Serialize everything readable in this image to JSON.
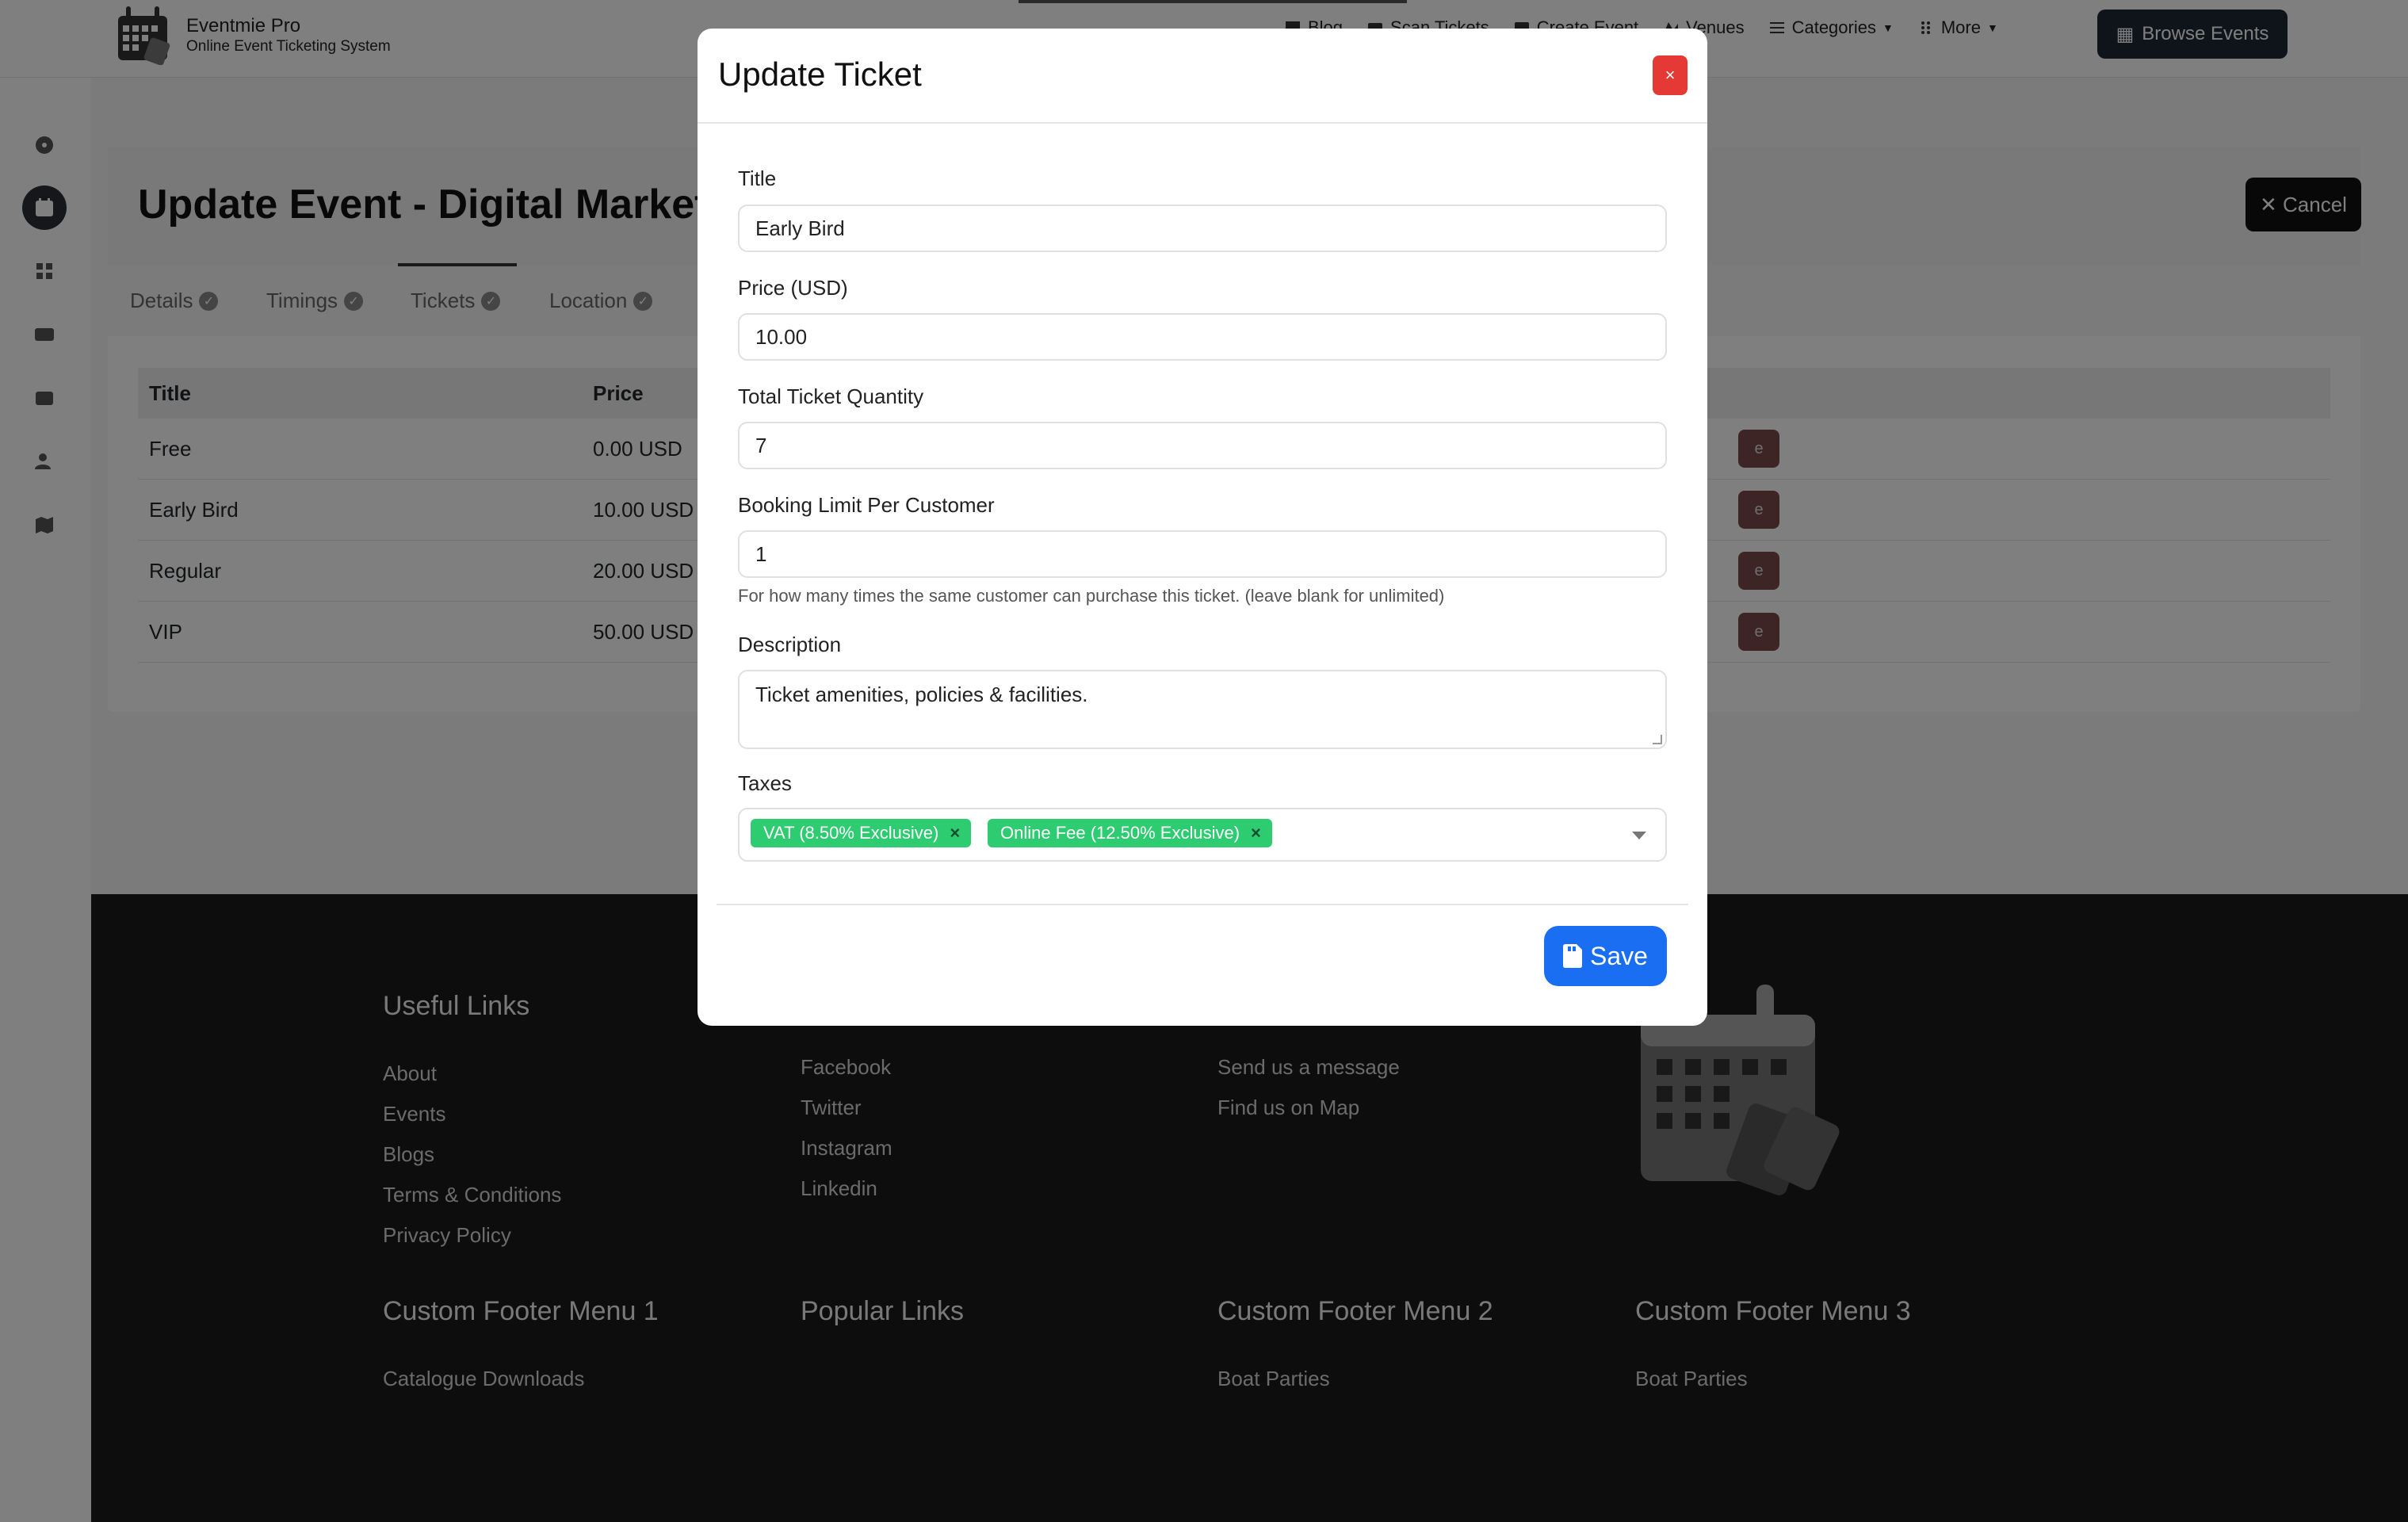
{
  "header": {
    "brand_name": "Eventmie Pro",
    "brand_tagline": "Online Event Ticketing System",
    "nav": [
      {
        "label": "Blog",
        "icon": "blog-icon"
      },
      {
        "label": "Scan Tickets",
        "icon": "ticket-icon"
      },
      {
        "label": "Create Event",
        "icon": "calendar-plus-icon"
      },
      {
        "label": "Venues",
        "icon": "venues-icon"
      },
      {
        "label": "Categories",
        "icon": "list-icon"
      },
      {
        "label": "More",
        "icon": "grid-dots-icon"
      }
    ],
    "browse_label": "Browse Events"
  },
  "sidebar": {
    "items": [
      "dashboard-icon",
      "calendar-icon",
      "apps-icon",
      "id-card-icon",
      "wallet-icon",
      "users-icon",
      "map-icon"
    ],
    "active": "calendar-icon"
  },
  "page": {
    "title": "Update Event - Digital Marketi",
    "cancel_label": "✕ Cancel",
    "tabs": [
      "Details",
      "Timings",
      "Tickets",
      "Location"
    ],
    "active_tab": "Tickets",
    "table": {
      "headers": [
        "Title",
        "Price"
      ],
      "rows": [
        {
          "title": "Free",
          "price": "0.00 USD"
        },
        {
          "title": "Early Bird",
          "price": "10.00 USD"
        },
        {
          "title": "Regular",
          "price": "20.00 USD"
        },
        {
          "title": "VIP",
          "price": "50.00 USD"
        }
      ]
    }
  },
  "footer": {
    "columns": [
      {
        "heading": "Useful Links",
        "links": [
          "About",
          "Events",
          "Blogs",
          "Terms & Conditions",
          "Privacy Policy"
        ]
      },
      {
        "heading": "",
        "links": [
          "Facebook",
          "Twitter",
          "Instagram",
          "Linkedin"
        ]
      },
      {
        "heading": "",
        "links": [
          "Send us a message",
          "Find us on Map"
        ]
      }
    ],
    "menus": [
      {
        "heading": "Custom Footer Menu 1",
        "links": [
          "Catalogue Downloads"
        ]
      },
      {
        "heading": "Popular Links",
        "links": []
      },
      {
        "heading": "Custom Footer Menu 2",
        "links": [
          "Boat Parties"
        ]
      },
      {
        "heading": "Custom Footer Menu 3",
        "links": [
          "Boat Parties"
        ]
      }
    ]
  },
  "modal": {
    "title": "Update Ticket",
    "close_label": "×",
    "fields": {
      "title_label": "Title",
      "title_value": "Early Bird",
      "price_label": "Price (USD)",
      "price_value": "10.00",
      "quantity_label": "Total Ticket Quantity",
      "quantity_value": "7",
      "limit_label": "Booking Limit Per Customer",
      "limit_value": "1",
      "limit_help": "For how many times the same customer can purchase this ticket. (leave blank for unlimited)",
      "description_label": "Description",
      "description_value": "Ticket amenities, policies & facilities.",
      "taxes_label": "Taxes",
      "taxes": [
        "VAT (8.50% Exclusive)",
        "Online Fee (12.50% Exclusive)"
      ]
    },
    "save_label": "Save"
  },
  "colors": {
    "primary": "#1a6ef2",
    "danger": "#e53935",
    "chip": "#2ecc71",
    "footer_bg": "#1a1a1a"
  }
}
